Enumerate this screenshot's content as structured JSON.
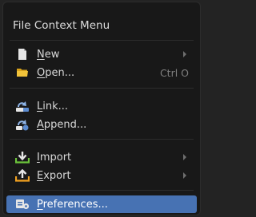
{
  "menu": {
    "title": "File Context Menu",
    "items": [
      {
        "underline": "N",
        "rest": "ew",
        "shortcut": "",
        "submenu": true,
        "icon": "file-new-icon"
      },
      {
        "underline": "O",
        "rest": "pen...",
        "shortcut": "Ctrl O",
        "submenu": false,
        "icon": "folder-open-icon"
      },
      {
        "underline": "L",
        "rest": "ink...",
        "shortcut": "",
        "submenu": false,
        "icon": "link-blend-icon"
      },
      {
        "underline": "A",
        "rest": "ppend...",
        "shortcut": "",
        "submenu": false,
        "icon": "append-blend-icon"
      },
      {
        "underline": "I",
        "rest": "mport",
        "shortcut": "",
        "submenu": true,
        "icon": "import-icon"
      },
      {
        "underline": "E",
        "rest": "xport",
        "shortcut": "",
        "submenu": true,
        "icon": "export-icon"
      },
      {
        "underline": "P",
        "rest": "references...",
        "shortcut": "",
        "submenu": false,
        "icon": "preferences-icon",
        "active": true
      }
    ]
  },
  "colors": {
    "background": "#232323",
    "menu_bg": "#181818",
    "highlight": "#4772b3",
    "text": "#d8d8d8",
    "shortcut_text": "#7e7e7e"
  }
}
